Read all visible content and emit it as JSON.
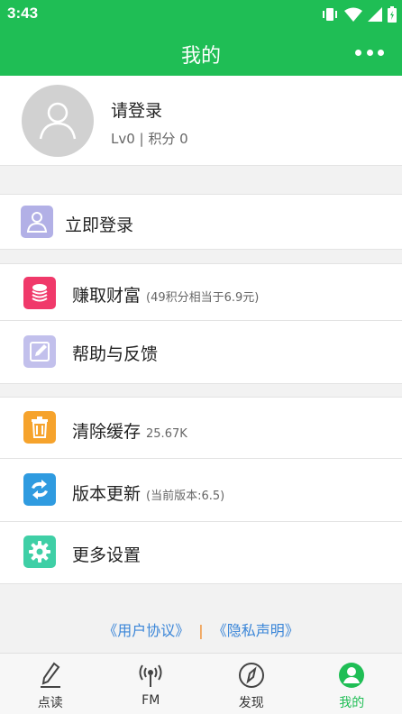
{
  "status_bar": {
    "time": "3:43"
  },
  "header": {
    "title": "我的",
    "more_icon": "more-horizontal-icon"
  },
  "profile": {
    "name": "请登录",
    "level": "Lv0 | 积分  0",
    "avatar_icon": "user-icon"
  },
  "login_row": {
    "label": "立即登录",
    "icon": "user-icon",
    "icon_color": "#9b9bd9"
  },
  "menu": {
    "earn": {
      "label": "赚取财富",
      "note": "(49积分相当于6.9元)",
      "icon": "coins-icon",
      "icon_color": "#f0396a"
    },
    "help": {
      "label": "帮助与反馈",
      "icon": "edit-icon",
      "icon_color": "#a9a6df"
    },
    "cache": {
      "label": "清除缓存",
      "note": "25.67K",
      "icon": "trash-icon",
      "icon_color": "#f6a32c"
    },
    "update": {
      "label": "版本更新",
      "note": "(当前版本:6.5)",
      "icon": "refresh-icon",
      "icon_color": "#2f9be0"
    },
    "settings": {
      "label": "更多设置",
      "icon": "gear-icon",
      "icon_color": "#3fcfa6"
    }
  },
  "footer": {
    "user_agreement": "《用户协议》",
    "separator": "|",
    "privacy": "《隐私声明》"
  },
  "tabs": [
    {
      "label": "点读",
      "icon": "pen-icon"
    },
    {
      "label": "FM",
      "icon": "radio-icon"
    },
    {
      "label": "发现",
      "icon": "compass-icon"
    },
    {
      "label": "我的",
      "icon": "profile-icon",
      "active": true
    }
  ],
  "colors": {
    "accent": "#1fbe55",
    "link": "#3b86d8",
    "separator": "#f08a2a"
  }
}
